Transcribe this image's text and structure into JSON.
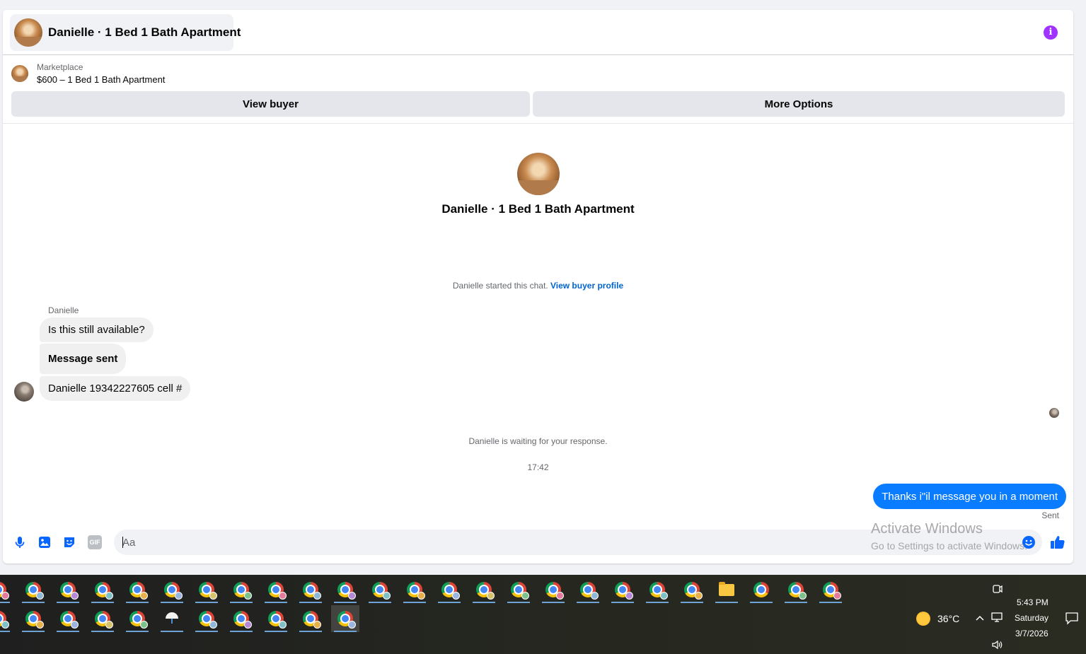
{
  "header": {
    "title": "Danielle · 1 Bed 1 Bath Apartment"
  },
  "listing": {
    "kicker": "Marketplace",
    "name": "$600 – 1 Bed 1 Bath Apartment"
  },
  "actions": {
    "view_buyer": "View buyer",
    "more_options": "More Options"
  },
  "profile": {
    "name": "Danielle · 1 Bed 1 Bath Apartment"
  },
  "chat": {
    "started_text": "Danielle started this chat.",
    "view_profile_link": "View buyer profile",
    "sender_name": "Danielle",
    "messages": [
      {
        "text": "Is this still available?"
      },
      {
        "text": "Message sent"
      },
      {
        "text": "Danielle  19342227605 cell #"
      }
    ],
    "waiting_text": "Danielle is waiting for your response.",
    "timestamp": "17:42",
    "outgoing": "Thanks i\"il message you in a moment",
    "sent_label": "Sent"
  },
  "composer": {
    "placeholder": "Aa",
    "gif_label": "GIF"
  },
  "watermark": {
    "line1": "Activate Windows",
    "line2": "Go to Settings to activate Windows."
  },
  "taskbar": {
    "weather": "36°C",
    "time": "5:43 PM",
    "day": "Saturday",
    "date": "3/7/2026"
  },
  "colors": {
    "accent": "#0866ff",
    "bubble_out": "#0a7cff",
    "info": "#a033ff"
  },
  "icons": [
    "info-icon",
    "mic-icon",
    "image-icon",
    "sticker-icon",
    "gif-icon",
    "emoji-icon",
    "like-icon",
    "chrome-icon",
    "folder-icon",
    "weather-icon",
    "chevron-up-icon",
    "network-icon",
    "volume-icon",
    "notification-icon",
    "meet-icon"
  ]
}
